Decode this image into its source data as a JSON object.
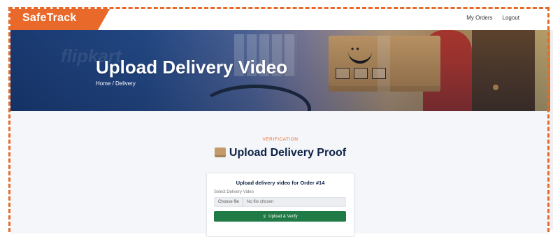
{
  "navbar": {
    "brand": "SafeTrack",
    "links": [
      "My Orders",
      "Logout"
    ]
  },
  "hero": {
    "title": "Upload Delivery Video",
    "breadcrumb": "Home / Delivery",
    "watermark": "flipkart"
  },
  "section": {
    "kicker": "VERIFICATION",
    "title": "Upload Delivery Proof",
    "icon": "package-icon"
  },
  "card": {
    "title": "Upload delivery video for Order #14",
    "field_label": "Select Delivery Video",
    "file_button": "Choose file",
    "file_status": "No file chosen",
    "submit_label": "Upload & Verify",
    "submit_icon": "upload-icon"
  },
  "colors": {
    "brand": "#e8692a",
    "heading": "#0e2247",
    "submit": "#1f7a46"
  }
}
